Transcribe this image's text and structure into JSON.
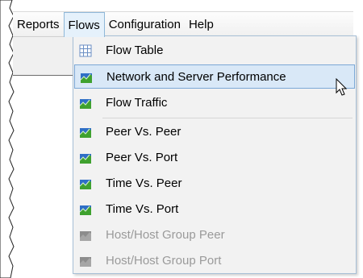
{
  "menubar": {
    "items": [
      {
        "label": "Reports"
      },
      {
        "label": "Flows"
      },
      {
        "label": "Configuration"
      },
      {
        "label": "Help"
      }
    ]
  },
  "dropdown": {
    "items": [
      {
        "label": "Flow Table",
        "icon": "table-icon",
        "enabled": true
      },
      {
        "label": "Network and Server Performance",
        "icon": "chart-icon",
        "enabled": true,
        "hovered": true
      },
      {
        "label": "Flow Traffic",
        "icon": "chart-icon",
        "enabled": true
      },
      {
        "label": "Peer Vs. Peer",
        "icon": "chart-icon",
        "enabled": true
      },
      {
        "label": "Peer Vs. Port",
        "icon": "chart-icon",
        "enabled": true
      },
      {
        "label": "Time Vs. Peer",
        "icon": "chart-icon",
        "enabled": true
      },
      {
        "label": "Time Vs. Port",
        "icon": "chart-icon",
        "enabled": true
      },
      {
        "label": "Host/Host Group Peer",
        "icon": "chart-icon",
        "enabled": false
      },
      {
        "label": "Host/Host Group Port",
        "icon": "chart-icon",
        "enabled": false
      }
    ]
  },
  "colors": {
    "accent_border": "#7aa7d6",
    "hover_fill": "#d9e8f7",
    "disabled_text": "#9a9a9a",
    "chart_green": "#3fa12f",
    "chart_blue": "#2f6fc6"
  }
}
